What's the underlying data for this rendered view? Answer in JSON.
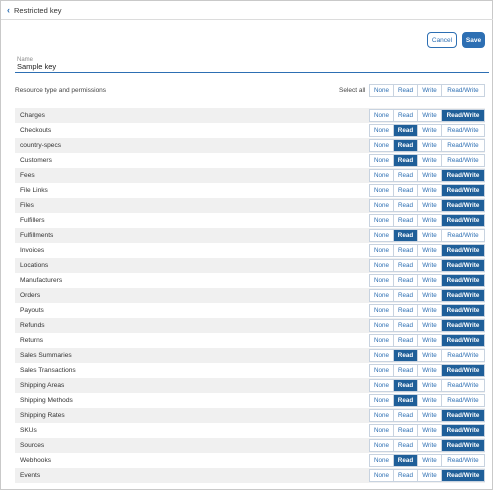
{
  "header": {
    "back_icon": "chevron-left-icon",
    "title": "Restricted key"
  },
  "actions": {
    "cancel": "Cancel",
    "save": "Save"
  },
  "name_field": {
    "label": "Name",
    "value": "Sample key"
  },
  "section": {
    "title": "Resource type and permissions",
    "select_all": "Select all"
  },
  "options": [
    "None",
    "Read",
    "Write",
    "Read/Write"
  ],
  "colors": {
    "accent": "#2d6fb3",
    "selected": "#1f5f99",
    "stripe": "#f0f0f0"
  },
  "resources": [
    {
      "name": "Charges",
      "selected": "Read/Write"
    },
    {
      "name": "Checkouts",
      "selected": "Read"
    },
    {
      "name": "country-specs",
      "selected": "Read"
    },
    {
      "name": "Customers",
      "selected": "Read"
    },
    {
      "name": "Fees",
      "selected": "Read/Write"
    },
    {
      "name": "File Links",
      "selected": "Read/Write"
    },
    {
      "name": "Files",
      "selected": "Read/Write"
    },
    {
      "name": "Fulfillers",
      "selected": "Read/Write"
    },
    {
      "name": "Fulfillments",
      "selected": "Read"
    },
    {
      "name": "Invoices",
      "selected": "Read/Write"
    },
    {
      "name": "Locations",
      "selected": "Read/Write"
    },
    {
      "name": "Manufacturers",
      "selected": "Read/Write"
    },
    {
      "name": "Orders",
      "selected": "Read/Write"
    },
    {
      "name": "Payouts",
      "selected": "Read/Write"
    },
    {
      "name": "Refunds",
      "selected": "Read/Write"
    },
    {
      "name": "Returns",
      "selected": "Read/Write"
    },
    {
      "name": "Sales Summaries",
      "selected": "Read"
    },
    {
      "name": "Sales Transactions",
      "selected": "Read/Write"
    },
    {
      "name": "Shipping Areas",
      "selected": "Read"
    },
    {
      "name": "Shipping Methods",
      "selected": "Read"
    },
    {
      "name": "Shipping Rates",
      "selected": "Read/Write"
    },
    {
      "name": "SKUs",
      "selected": "Read/Write"
    },
    {
      "name": "Sources",
      "selected": "Read/Write"
    },
    {
      "name": "Webhooks",
      "selected": "Read"
    },
    {
      "name": "Events",
      "selected": "Read/Write"
    }
  ]
}
